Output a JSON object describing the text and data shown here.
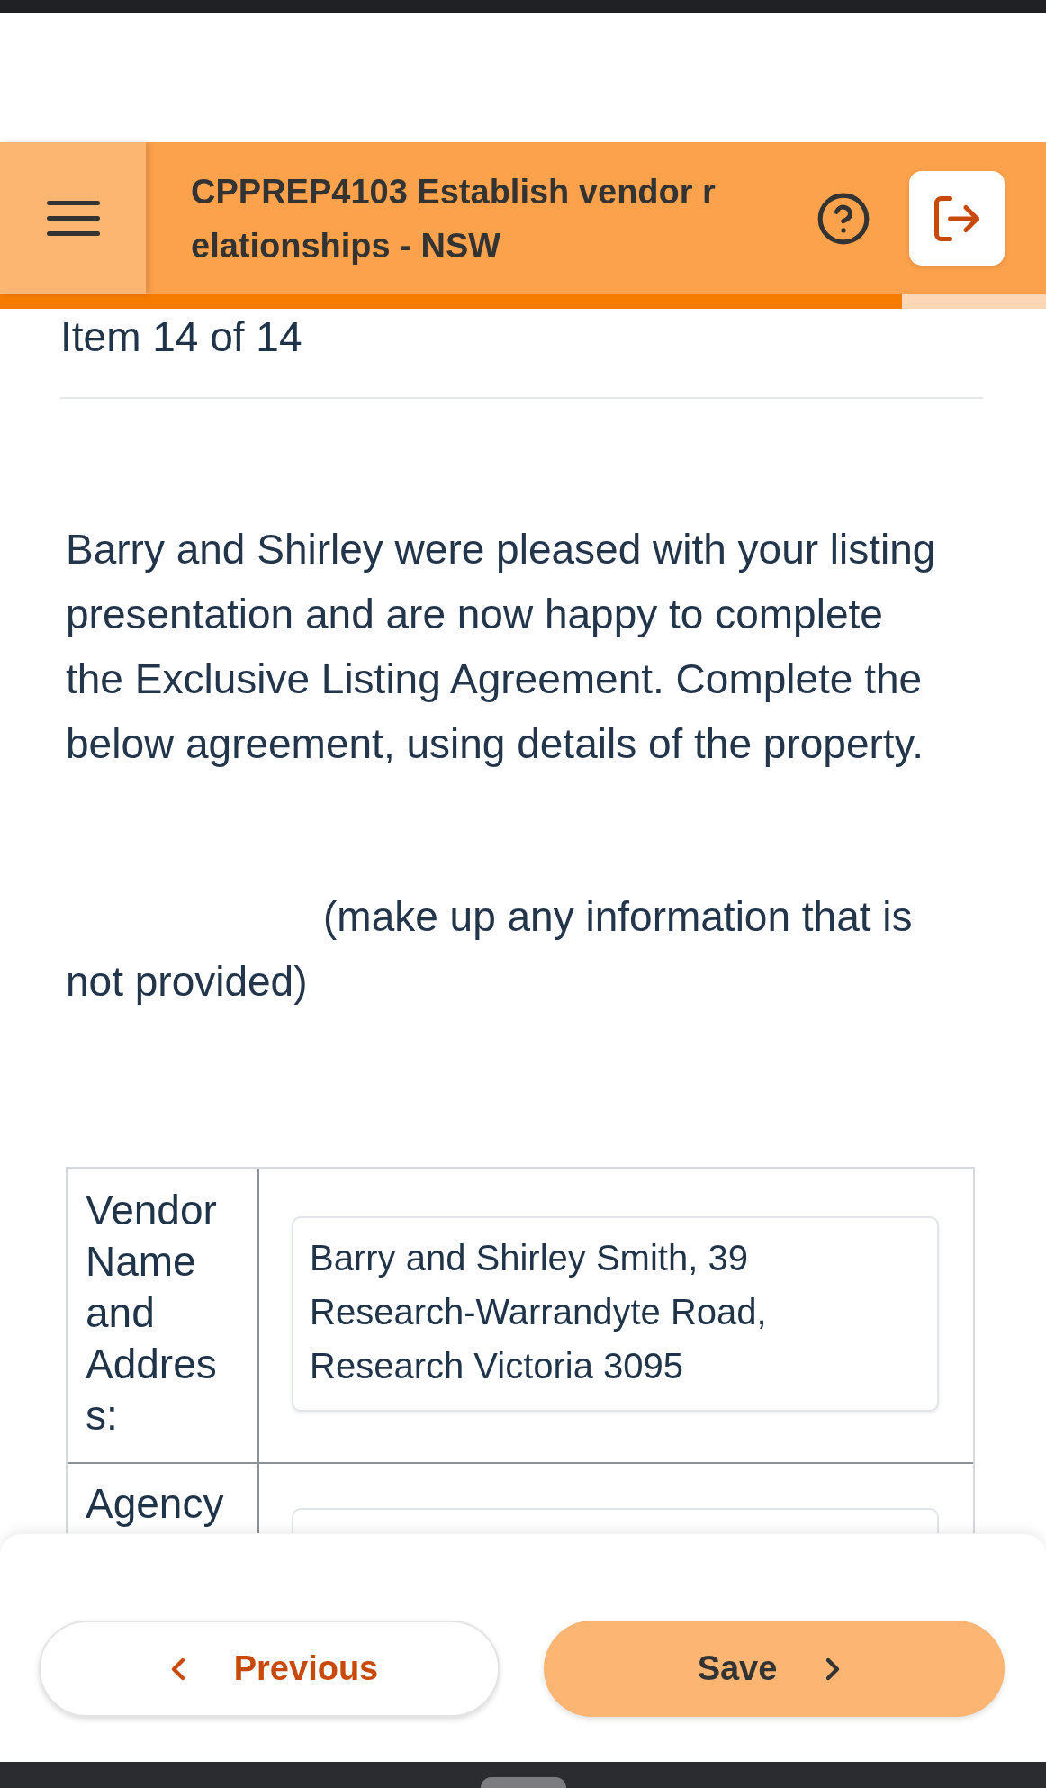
{
  "header": {
    "title_lines": [
      "CPPREP4103 Establish vendor r",
      "elationships - NSW"
    ]
  },
  "progress": {
    "level": 0.862
  },
  "item_counter": "Item 14 of 14",
  "instructions": [
    "Barry and Shirley were pleased with your listing presentation and are now happy to complete the Exclusive Listing Agreement. Complete the below agreement, using details of the property.",
    "(make up any information that is not provided)"
  ],
  "table": {
    "rows": [
      {
        "label": "Vendor Name and Address:",
        "value": "Barry and Shirley Smith, 39 Research-Warrandyte Road, Research Victoria 3095"
      },
      {
        "label": "Agency"
      }
    ]
  },
  "footer": {
    "buttons": [
      {
        "label": "Previous",
        "kind": "secondary"
      },
      {
        "label": "Save",
        "kind": "primary"
      }
    ]
  }
}
